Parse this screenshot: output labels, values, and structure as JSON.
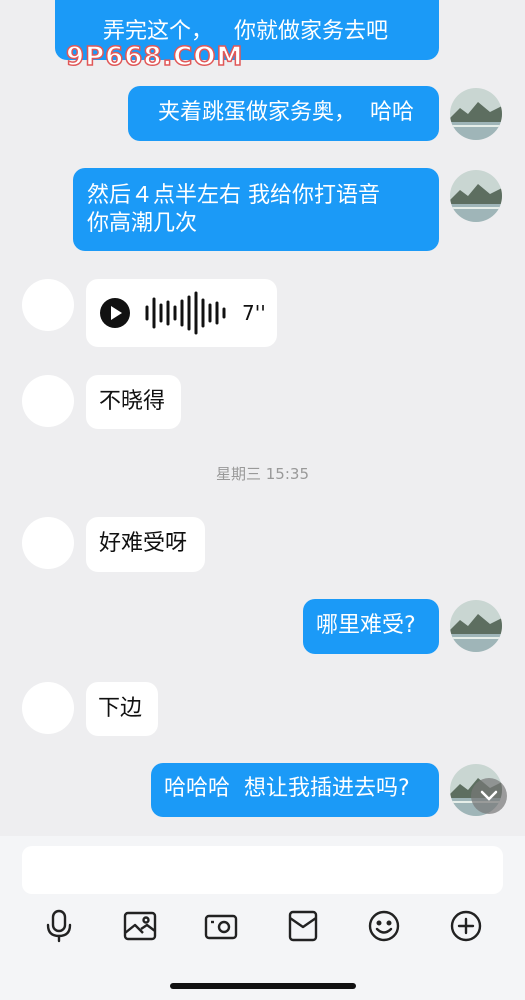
{
  "messages": [
    {
      "text": "弄完这个，   你就做家务去吧"
    },
    {
      "text": "夹着跳蛋做家务奥，  哈哈"
    },
    {
      "text": "然后４点半左右 我给你打语音\n你高潮几次"
    },
    {
      "voice_duration": "7''"
    },
    {
      "text": "不晓得"
    },
    {
      "timestamp": "星期三 15:35"
    },
    {
      "text": "好难受呀"
    },
    {
      "text": "哪里难受?"
    },
    {
      "text": "下边"
    },
    {
      "text": "哈哈哈  想让我插进去吗?"
    }
  ],
  "watermark": "9P668.COM",
  "input": {
    "placeholder": ""
  },
  "toolbar": [
    "microphone-icon",
    "image-icon",
    "camera-icon",
    "red-packet-icon",
    "emoji-icon",
    "plus-icon"
  ],
  "colors": {
    "outgoing": "#1b9af7",
    "incoming": "#ffffff",
    "background": "#eeeef0"
  }
}
